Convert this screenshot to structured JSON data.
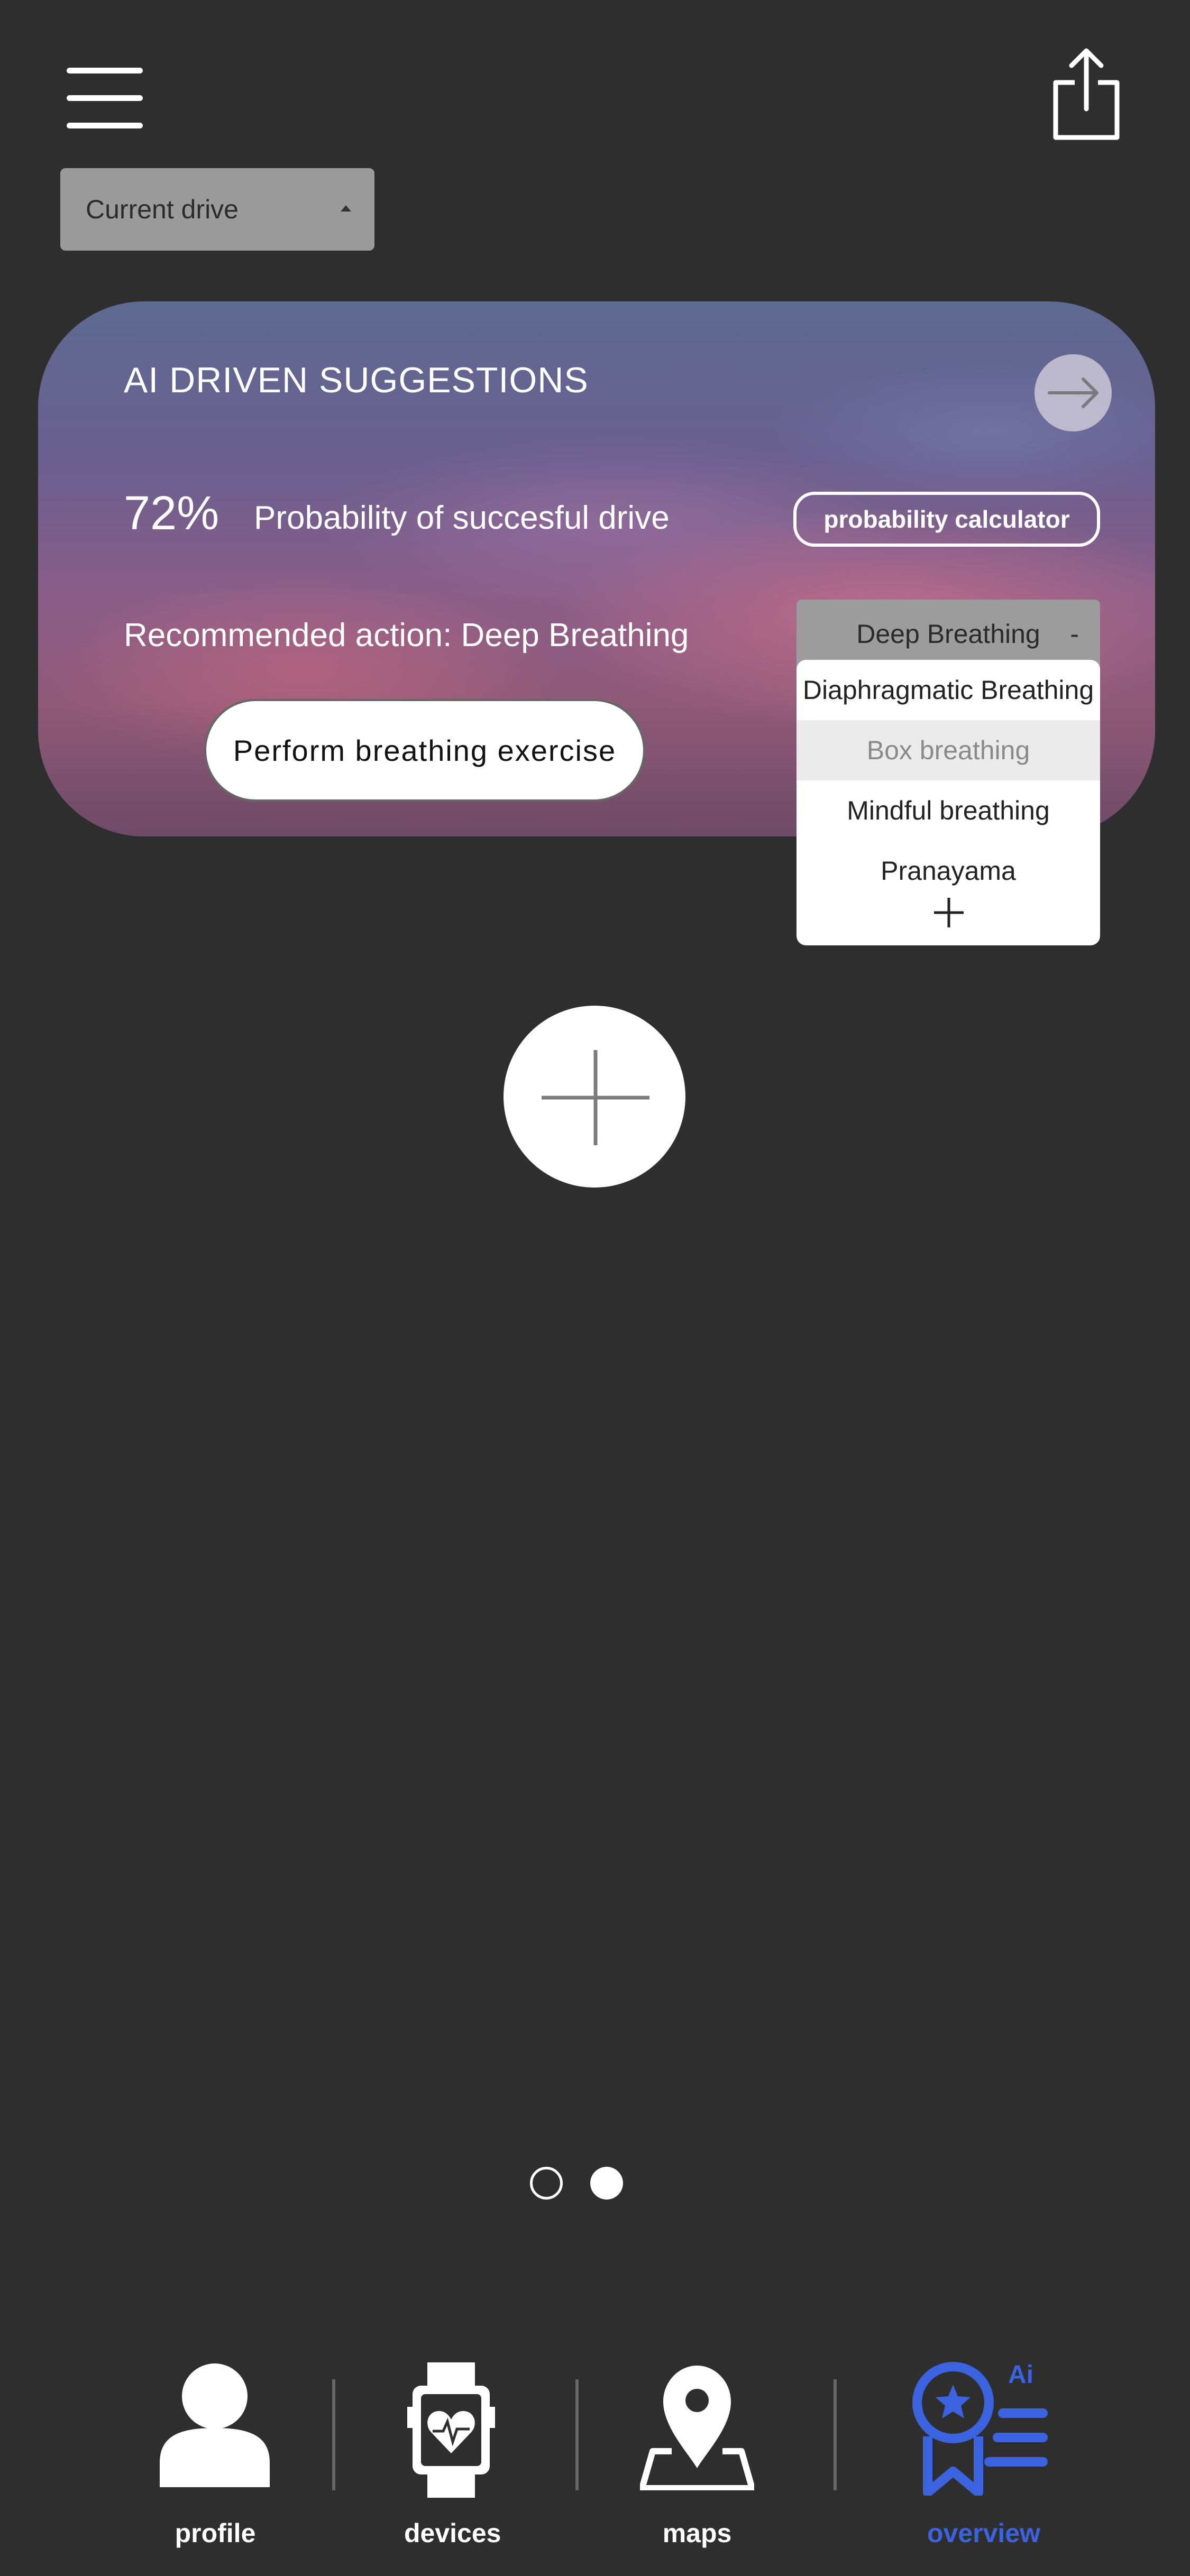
{
  "header": {
    "menu_icon": "hamburger-menu-icon",
    "share_icon": "share-icon",
    "drive_select": {
      "value": "Current drive"
    }
  },
  "suggestions": {
    "title": "AI DRIVEN SUGGESTIONS",
    "probability_value": "72%",
    "probability_label": "Probability of succesful drive",
    "calculator_label": "probability calculator",
    "recommendation": "Recommended action: Deep Breathing",
    "perform_label": "Perform breathing exercise",
    "dropdown": {
      "selected": "Deep Breathing",
      "toggle": "-",
      "options": [
        "Diaphragmatic Breathing",
        "Box breathing",
        "Mindful breathing",
        "Pranayama"
      ],
      "highlighted_index": 1
    }
  },
  "pager": {
    "count": 2,
    "active_index": 1
  },
  "nav": {
    "items": [
      {
        "label": "profile",
        "icon": "person-icon"
      },
      {
        "label": "devices",
        "icon": "smartwatch-heart-icon"
      },
      {
        "label": "maps",
        "icon": "map-pin-icon"
      },
      {
        "label": "overview",
        "icon": "ai-award-icon",
        "badge": "Ai",
        "active": true
      }
    ]
  },
  "colors": {
    "background": "#2e2e2e",
    "accent": "#3b63e0",
    "dropdown_header": "#9c9c9c"
  }
}
